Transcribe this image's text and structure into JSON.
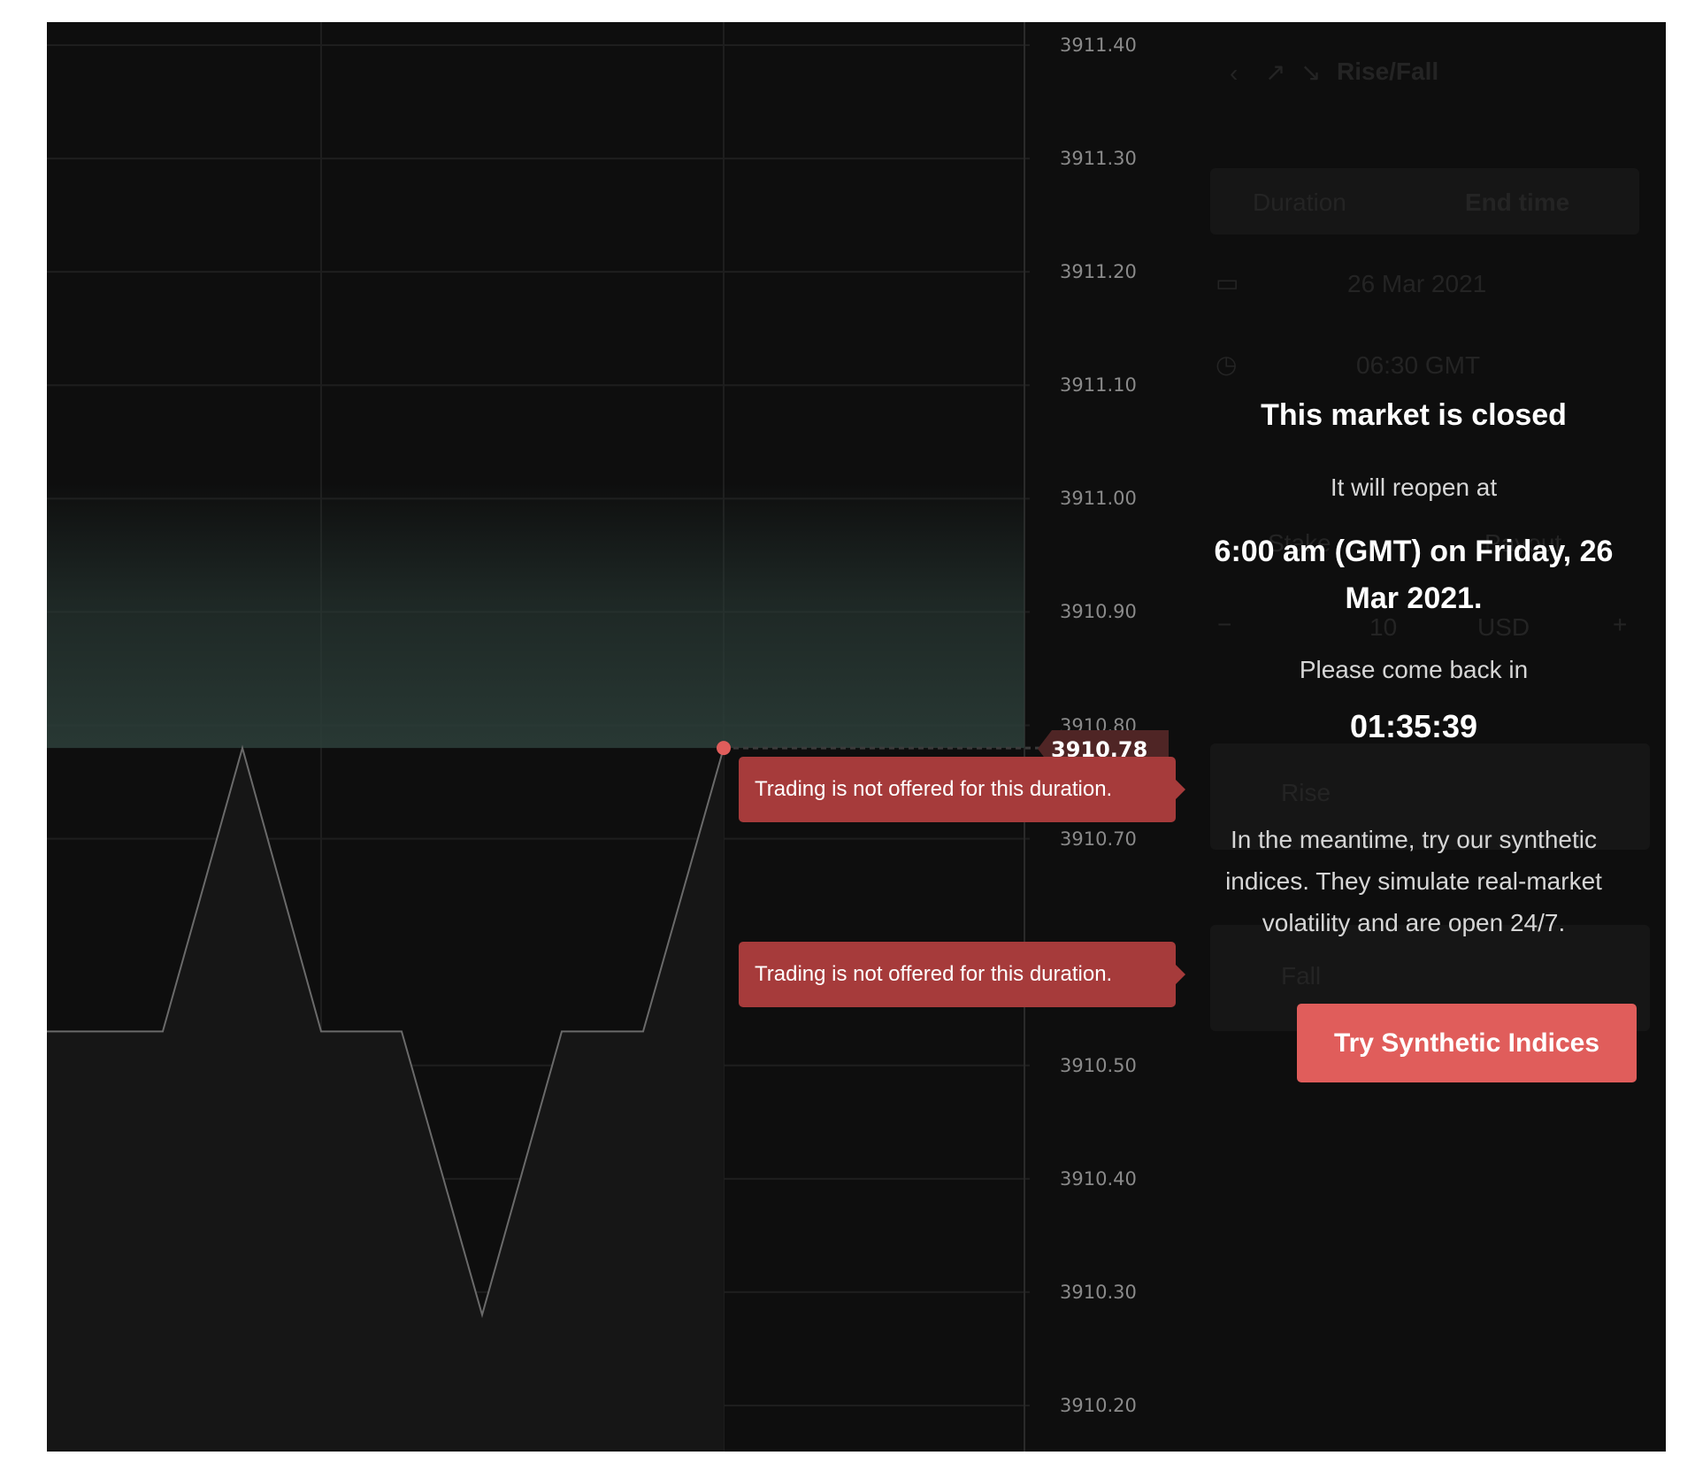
{
  "chart_data": {
    "type": "line",
    "y_ticks": [
      "3911.40",
      "3911.30",
      "3911.20",
      "3911.10",
      "3911.00",
      "3910.90",
      "3910.80",
      "3910.70",
      "3910.50",
      "3910.40",
      "3910.30",
      "3910.20"
    ],
    "ylim": [
      3910.2,
      3911.4
    ],
    "series": [
      {
        "values": [
          3910.53,
          3910.53,
          3910.78,
          3910.53,
          3910.53,
          3910.28,
          3910.53,
          3910.53,
          3910.78
        ]
      }
    ],
    "current_price": "3910.78",
    "colors": {
      "line": "#6a6a6a",
      "marker": "#e05d5b",
      "barrier_zone": "#2b3d38",
      "grid": "#1e1e1e"
    }
  },
  "tooltips": [
    {
      "text": "Trading is not offered for this duration."
    },
    {
      "text": "Trading is not offered for this duration."
    }
  ],
  "background_panel": {
    "title": "Rise/Fall",
    "tabs": [
      "Duration",
      "End time"
    ],
    "date": "26 Mar 2021",
    "time": "06:30 GMT",
    "stake_tabs": [
      "Stake",
      "Payout"
    ],
    "stake_value": "10",
    "currency": "USD",
    "rise_label": "Rise",
    "fall_label": "Fall",
    "icons": [
      "chevron-left-icon",
      "rise-arrow-icon",
      "fall-arrow-icon",
      "calendar-icon",
      "clock-icon",
      "minus-icon",
      "plus-icon"
    ]
  },
  "market_closed": {
    "title": "This market is closed",
    "reopen_label": "It will reopen at",
    "reopen_time": "6:00 am (GMT) on Friday, 26 Mar 2021.",
    "come_back_label": "Please come back in",
    "countdown": "01:35:39",
    "meantime_text": "In the meantime, try our synthetic indices. They simulate real-market volatility and are open 24/7.",
    "button_label": "Try Synthetic Indices"
  }
}
